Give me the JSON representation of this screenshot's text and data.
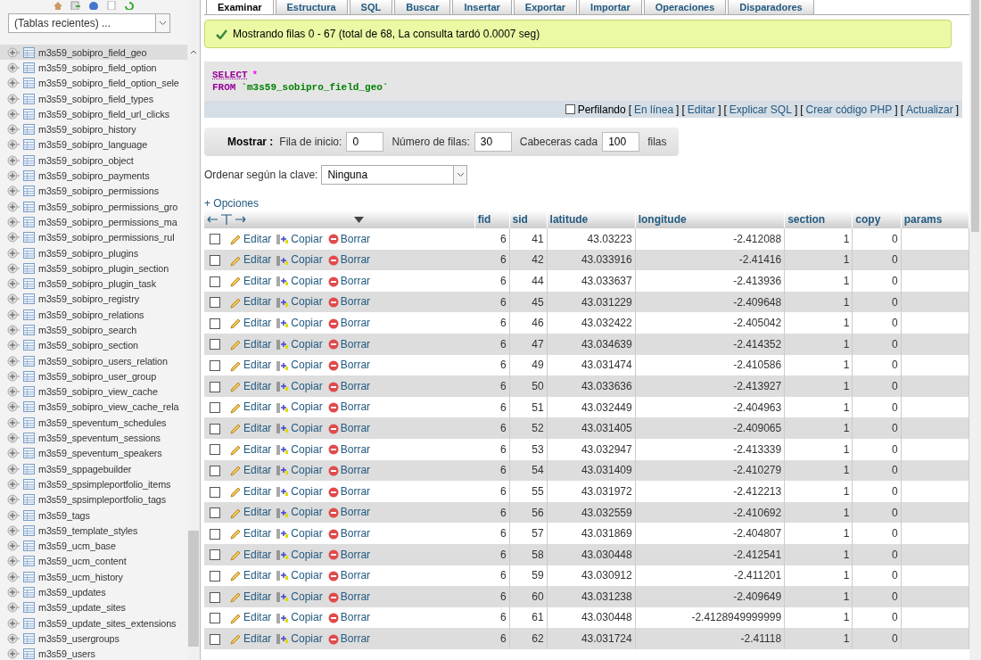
{
  "recent_tables": {
    "value": "(Tablas recientes) ..."
  },
  "sidebar": {
    "items": [
      {
        "label": "m3s59_sobipro_field_geo",
        "selected": true
      },
      {
        "label": "m3s59_sobipro_field_option",
        "selected": false
      },
      {
        "label": "m3s59_sobipro_field_option_sele",
        "selected": false
      },
      {
        "label": "m3s59_sobipro_field_types",
        "selected": false
      },
      {
        "label": "m3s59_sobipro_field_url_clicks",
        "selected": false
      },
      {
        "label": "m3s59_sobipro_history",
        "selected": false
      },
      {
        "label": "m3s59_sobipro_language",
        "selected": false
      },
      {
        "label": "m3s59_sobipro_object",
        "selected": false
      },
      {
        "label": "m3s59_sobipro_payments",
        "selected": false
      },
      {
        "label": "m3s59_sobipro_permissions",
        "selected": false
      },
      {
        "label": "m3s59_sobipro_permissions_gro",
        "selected": false
      },
      {
        "label": "m3s59_sobipro_permissions_ma",
        "selected": false
      },
      {
        "label": "m3s59_sobipro_permissions_rul",
        "selected": false
      },
      {
        "label": "m3s59_sobipro_plugins",
        "selected": false
      },
      {
        "label": "m3s59_sobipro_plugin_section",
        "selected": false
      },
      {
        "label": "m3s59_sobipro_plugin_task",
        "selected": false
      },
      {
        "label": "m3s59_sobipro_registry",
        "selected": false
      },
      {
        "label": "m3s59_sobipro_relations",
        "selected": false
      },
      {
        "label": "m3s59_sobipro_search",
        "selected": false
      },
      {
        "label": "m3s59_sobipro_section",
        "selected": false
      },
      {
        "label": "m3s59_sobipro_users_relation",
        "selected": false
      },
      {
        "label": "m3s59_sobipro_user_group",
        "selected": false
      },
      {
        "label": "m3s59_sobipro_view_cache",
        "selected": false
      },
      {
        "label": "m3s59_sobipro_view_cache_rela",
        "selected": false
      },
      {
        "label": "m3s59_speventum_schedules",
        "selected": false
      },
      {
        "label": "m3s59_speventum_sessions",
        "selected": false
      },
      {
        "label": "m3s59_speventum_speakers",
        "selected": false
      },
      {
        "label": "m3s59_sppagebuilder",
        "selected": false
      },
      {
        "label": "m3s59_spsimpleportfolio_items",
        "selected": false
      },
      {
        "label": "m3s59_spsimpleportfolio_tags",
        "selected": false
      },
      {
        "label": "m3s59_tags",
        "selected": false
      },
      {
        "label": "m3s59_template_styles",
        "selected": false
      },
      {
        "label": "m3s59_ucm_base",
        "selected": false
      },
      {
        "label": "m3s59_ucm_content",
        "selected": false
      },
      {
        "label": "m3s59_ucm_history",
        "selected": false
      },
      {
        "label": "m3s59_updates",
        "selected": false
      },
      {
        "label": "m3s59_update_sites",
        "selected": false
      },
      {
        "label": "m3s59_update_sites_extensions",
        "selected": false
      },
      {
        "label": "m3s59_usergroups",
        "selected": false
      },
      {
        "label": "m3s59_users",
        "selected": false
      }
    ]
  },
  "tabs": [
    {
      "label": "Examinar",
      "selected": true
    },
    {
      "label": "Estructura",
      "selected": false
    },
    {
      "label": "SQL",
      "selected": false
    },
    {
      "label": "Buscar",
      "selected": false
    },
    {
      "label": "Insertar",
      "selected": false
    },
    {
      "label": "Exportar",
      "selected": false
    },
    {
      "label": "Importar",
      "selected": false
    },
    {
      "label": "Operaciones",
      "selected": false
    },
    {
      "label": "Disparadores",
      "selected": false
    }
  ],
  "message": "Mostrando filas 0 - 67 (total de 68, La consulta tardó 0.0007 seg)",
  "query": {
    "select": "SELECT",
    "star": "*",
    "from": "FROM",
    "table": "`m3s59_sobipro_field_geo`"
  },
  "query_tools": {
    "profiling": {
      "label": "Perfilando",
      "checked": false
    },
    "open": "[",
    "close": "]",
    "links": [
      "En línea",
      "Editar",
      "Explicar SQL",
      "Crear código PHP",
      "Actualizar"
    ]
  },
  "navigation": {
    "label": "Mostrar :",
    "fields": [
      {
        "label": "Fila de inicio:",
        "value": "0"
      },
      {
        "label": "Número de filas:",
        "value": "30"
      },
      {
        "label": "Cabeceras cada",
        "value": "100"
      }
    ],
    "suffix": "filas"
  },
  "sort": {
    "label": "Ordenar según la clave:",
    "value": "Ninguna"
  },
  "options_link": "+ Opciones",
  "table": {
    "columns": [
      "fid",
      "sid",
      "latitude",
      "longitude",
      "section",
      "copy",
      "params"
    ],
    "rows": [
      {
        "checked": false,
        "actions": [
          "Editar",
          "Copiar",
          "Borrar"
        ],
        "cells": [
          "6",
          "41",
          "43.03223",
          "-2.412088",
          "1",
          "0"
        ]
      },
      {
        "checked": false,
        "actions": [
          "Editar",
          "Copiar",
          "Borrar"
        ],
        "cells": [
          "6",
          "42",
          "43.033916",
          "-2.41416",
          "1",
          "0"
        ]
      },
      {
        "checked": false,
        "actions": [
          "Editar",
          "Copiar",
          "Borrar"
        ],
        "cells": [
          "6",
          "44",
          "43.033637",
          "-2.413936",
          "1",
          "0"
        ]
      },
      {
        "checked": false,
        "actions": [
          "Editar",
          "Copiar",
          "Borrar"
        ],
        "cells": [
          "6",
          "45",
          "43.031229",
          "-2.409648",
          "1",
          "0"
        ]
      },
      {
        "checked": false,
        "actions": [
          "Editar",
          "Copiar",
          "Borrar"
        ],
        "cells": [
          "6",
          "46",
          "43.032422",
          "-2.405042",
          "1",
          "0"
        ]
      },
      {
        "checked": false,
        "actions": [
          "Editar",
          "Copiar",
          "Borrar"
        ],
        "cells": [
          "6",
          "47",
          "43.034639",
          "-2.414352",
          "1",
          "0"
        ]
      },
      {
        "checked": false,
        "actions": [
          "Editar",
          "Copiar",
          "Borrar"
        ],
        "cells": [
          "6",
          "49",
          "43.031474",
          "-2.410586",
          "1",
          "0"
        ]
      },
      {
        "checked": false,
        "actions": [
          "Editar",
          "Copiar",
          "Borrar"
        ],
        "cells": [
          "6",
          "50",
          "43.033636",
          "-2.413927",
          "1",
          "0"
        ]
      },
      {
        "checked": false,
        "actions": [
          "Editar",
          "Copiar",
          "Borrar"
        ],
        "cells": [
          "6",
          "51",
          "43.032449",
          "-2.404963",
          "1",
          "0"
        ]
      },
      {
        "checked": false,
        "actions": [
          "Editar",
          "Copiar",
          "Borrar"
        ],
        "cells": [
          "6",
          "52",
          "43.031405",
          "-2.409065",
          "1",
          "0"
        ]
      },
      {
        "checked": false,
        "actions": [
          "Editar",
          "Copiar",
          "Borrar"
        ],
        "cells": [
          "6",
          "53",
          "43.032947",
          "-2.413339",
          "1",
          "0"
        ]
      },
      {
        "checked": false,
        "actions": [
          "Editar",
          "Copiar",
          "Borrar"
        ],
        "cells": [
          "6",
          "54",
          "43.031409",
          "-2.410279",
          "1",
          "0"
        ]
      },
      {
        "checked": false,
        "actions": [
          "Editar",
          "Copiar",
          "Borrar"
        ],
        "cells": [
          "6",
          "55",
          "43.031972",
          "-2.412213",
          "1",
          "0"
        ]
      },
      {
        "checked": false,
        "actions": [
          "Editar",
          "Copiar",
          "Borrar"
        ],
        "cells": [
          "6",
          "56",
          "43.032559",
          "-2.410692",
          "1",
          "0"
        ]
      },
      {
        "checked": false,
        "actions": [
          "Editar",
          "Copiar",
          "Borrar"
        ],
        "cells": [
          "6",
          "57",
          "43.031869",
          "-2.404807",
          "1",
          "0"
        ]
      },
      {
        "checked": false,
        "actions": [
          "Editar",
          "Copiar",
          "Borrar"
        ],
        "cells": [
          "6",
          "58",
          "43.030448",
          "-2.412541",
          "1",
          "0"
        ]
      },
      {
        "checked": false,
        "actions": [
          "Editar",
          "Copiar",
          "Borrar"
        ],
        "cells": [
          "6",
          "59",
          "43.030912",
          "-2.411201",
          "1",
          "0"
        ]
      },
      {
        "checked": false,
        "actions": [
          "Editar",
          "Copiar",
          "Borrar"
        ],
        "cells": [
          "6",
          "60",
          "43.031238",
          "-2.409649",
          "1",
          "0"
        ]
      },
      {
        "checked": false,
        "actions": [
          "Editar",
          "Copiar",
          "Borrar"
        ],
        "cells": [
          "6",
          "61",
          "43.030448",
          "-2.4128949999999",
          "1",
          "0"
        ]
      },
      {
        "checked": false,
        "actions": [
          "Editar",
          "Copiar",
          "Borrar"
        ],
        "cells": [
          "6",
          "62",
          "43.031724",
          "-2.41118",
          "1",
          "0"
        ]
      }
    ]
  }
}
